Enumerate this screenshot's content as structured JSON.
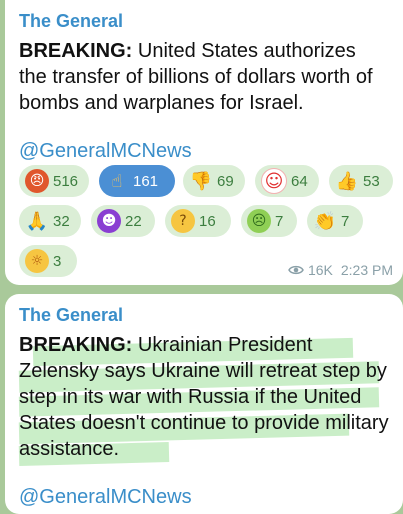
{
  "messages": [
    {
      "channel": "The General",
      "bold": "BREAKING:",
      "body": " United States authorizes the transfer of billions of dollars worth of bombs and warplanes for Israel.",
      "link": "@GeneralMCNews",
      "reactions": [
        {
          "icon": "angry-swearing-icon",
          "glyph": "🤬",
          "count": "516",
          "selected": false
        },
        {
          "icon": "pointing-up-icon",
          "glyph": "☝",
          "count": "161",
          "selected": true
        },
        {
          "icon": "thumbs-down-icon",
          "glyph": "👎",
          "count": "69",
          "selected": false
        },
        {
          "icon": "clown-icon",
          "glyph": "🤡",
          "count": "64",
          "selected": false
        },
        {
          "icon": "thumbs-up-icon",
          "glyph": "👍",
          "count": "53",
          "selected": false
        },
        {
          "icon": "folded-hands-icon",
          "glyph": "🙏",
          "count": "32",
          "selected": false
        },
        {
          "icon": "devil-icon",
          "glyph": "😈",
          "count": "22",
          "selected": false
        },
        {
          "icon": "thinking-icon",
          "glyph": "🤔",
          "count": "16",
          "selected": false
        },
        {
          "icon": "nauseated-icon",
          "glyph": "🤢",
          "count": "7",
          "selected": false
        },
        {
          "icon": "clapping-icon",
          "glyph": "👏",
          "count": "7",
          "selected": false
        },
        {
          "icon": "exploding-head-icon",
          "glyph": "🤯",
          "count": "3",
          "selected": false
        }
      ],
      "views": "16K",
      "time": "2:23 PM"
    },
    {
      "channel": "The General",
      "bold": "BREAKING:",
      "body": " Ukrainian President Zelensky says Ukraine will retreat step by step in its war with Russia if the United States doesn't continue to provide military assistance.",
      "link": "@GeneralMCNews"
    }
  ],
  "colors": {
    "accent": "#3a8ec9",
    "reaction_bg": "#dbeed6",
    "selected_bg": "#4b8fd4",
    "highlight": "#9fe09b"
  }
}
